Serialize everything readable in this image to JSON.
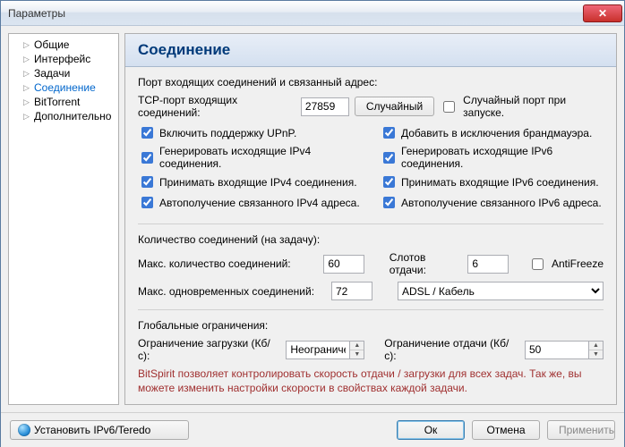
{
  "window": {
    "title": "Параметры"
  },
  "sidebar": {
    "items": [
      {
        "label": "Общие"
      },
      {
        "label": "Интерфейс"
      },
      {
        "label": "Задачи"
      },
      {
        "label": "Соединение"
      },
      {
        "label": "BitTorrent"
      },
      {
        "label": "Дополнительно"
      }
    ]
  },
  "page": {
    "heading": "Соединение",
    "port_group": "Порт входящих соединений и связанный адрес:",
    "port_label": "TCP-порт входящих соединений:",
    "port_value": "27859",
    "random_btn": "Случайный",
    "random_on_start": "Случайный порт при запуске.",
    "cb": {
      "upnp": "Включить поддержку UPnP.",
      "firewall": "Добавить в исключения брандмауэра.",
      "out4": "Генерировать исходящие IPv4 соединения.",
      "out6": "Генерировать исходящие IPv6 соединения.",
      "in4": "Принимать входящие IPv4 соединения.",
      "in6": "Принимать входящие IPv6 соединения.",
      "bind4": "Автополучение связанного IPv4 адреса.",
      "bind6": "Автополучение связанного IPv6 адреса."
    },
    "conn_group": "Количество соединений (на задачу):",
    "max_conn_label": "Макс. количество соединений:",
    "max_conn_value": "60",
    "slots_label": "Слотов отдачи:",
    "slots_value": "6",
    "antifreeze": "AntiFreeze",
    "max_half_label": "Макс. одновременных соединений:",
    "max_half_value": "72",
    "profile": "ADSL / Кабель",
    "limits_group": "Глобальные ограничения:",
    "dl_limit_label": "Ограничение загрузки (Кб/с):",
    "dl_limit_value": "Неограничен",
    "ul_limit_label": "Ограничение отдачи (Кб/с):",
    "ul_limit_value": "50",
    "hint": "BitSpirit позволяет контролировать скорость отдачи / загрузки для всех задач. Так же, вы можете изменить настройки скорости в свойствах каждой задачи."
  },
  "footer": {
    "install": "Установить IPv6/Teredo",
    "ok": "Ок",
    "cancel": "Отмена",
    "apply": "Применить"
  }
}
